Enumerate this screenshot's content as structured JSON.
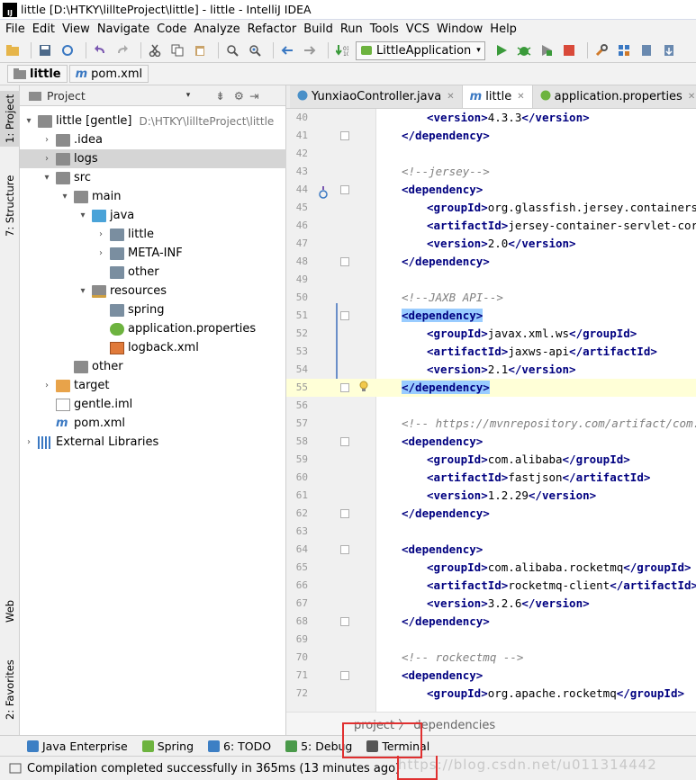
{
  "window": {
    "title": "little [D:\\HTKY\\lillteProject\\little] - little - IntelliJ IDEA",
    "app_icon_text": "IJ"
  },
  "menu": [
    "File",
    "Edit",
    "View",
    "Navigate",
    "Code",
    "Analyze",
    "Refactor",
    "Build",
    "Run",
    "Tools",
    "VCS",
    "Window",
    "Help"
  ],
  "toolbar": {
    "run_config": "LittleApplication"
  },
  "navbar": {
    "project": "little",
    "file": "pom.xml"
  },
  "left_tabs": {
    "project": "1: Project",
    "structure": "7: Structure",
    "web": "Web",
    "favorites": "2: Favorites"
  },
  "project_panel": {
    "title": "Project"
  },
  "tree": [
    {
      "label": "little [gentle]",
      "extra": "D:\\HTKY\\lillteProject\\little",
      "arrow": "▾",
      "icon": "folder",
      "depth": 0
    },
    {
      "label": ".idea",
      "arrow": "›",
      "icon": "folder",
      "depth": 1
    },
    {
      "label": "logs",
      "arrow": "›",
      "icon": "folder",
      "depth": 1
    },
    {
      "label": "src",
      "arrow": "▾",
      "icon": "folder",
      "depth": 1
    },
    {
      "label": "main",
      "arrow": "▾",
      "icon": "folder",
      "depth": 2
    },
    {
      "label": "java",
      "arrow": "▾",
      "icon": "folder-blue",
      "depth": 3
    },
    {
      "label": "little",
      "arrow": "›",
      "icon": "package",
      "depth": 4
    },
    {
      "label": "META-INF",
      "arrow": "›",
      "icon": "package",
      "depth": 4
    },
    {
      "label": "other",
      "arrow": "",
      "icon": "package",
      "depth": 4
    },
    {
      "label": "resources",
      "arrow": "▾",
      "icon": "folder-res",
      "depth": 3
    },
    {
      "label": "spring",
      "arrow": "",
      "icon": "package",
      "depth": 4
    },
    {
      "label": "application.properties",
      "arrow": "",
      "icon": "properties",
      "depth": 4
    },
    {
      "label": "logback.xml",
      "arrow": "",
      "icon": "xml",
      "depth": 4
    },
    {
      "label": "other",
      "arrow": "",
      "icon": "folder",
      "depth": 2
    },
    {
      "label": "target",
      "arrow": "›",
      "icon": "folder-orange",
      "depth": 1
    },
    {
      "label": "gentle.iml",
      "arrow": "",
      "icon": "iml",
      "depth": 1
    },
    {
      "label": "pom.xml",
      "arrow": "",
      "icon": "maven",
      "depth": 1
    },
    {
      "label": "External Libraries",
      "arrow": "›",
      "icon": "libraries",
      "depth": 0
    }
  ],
  "editor_tabs": [
    {
      "label": "YunxiaoController.java",
      "icon": "class",
      "active": false
    },
    {
      "label": "little",
      "icon": "maven",
      "active": true
    },
    {
      "label": "application.properties",
      "icon": "properties",
      "active": false
    }
  ],
  "code_lines": [
    {
      "n": "40",
      "indent": 2,
      "parts": [
        [
          "tag",
          "<version>"
        ],
        [
          "text",
          "4.3.3"
        ],
        [
          "tag",
          "</version>"
        ]
      ]
    },
    {
      "n": "41",
      "indent": 1,
      "parts": [
        [
          "tag",
          "</dependency>"
        ]
      ]
    },
    {
      "n": "42",
      "indent": 0,
      "parts": []
    },
    {
      "n": "43",
      "indent": 1,
      "parts": [
        [
          "comment",
          "<!--jersey-->"
        ]
      ]
    },
    {
      "n": "44",
      "indent": 1,
      "parts": [
        [
          "tag",
          "<dependency>"
        ]
      ]
    },
    {
      "n": "45",
      "indent": 2,
      "parts": [
        [
          "tag",
          "<groupId>"
        ],
        [
          "text",
          "org.glassfish.jersey.containers"
        ],
        [
          "tag",
          "</"
        ]
      ]
    },
    {
      "n": "46",
      "indent": 2,
      "parts": [
        [
          "tag",
          "<artifactId>"
        ],
        [
          "text",
          "jersey-container-servlet-core"
        ]
      ]
    },
    {
      "n": "47",
      "indent": 2,
      "parts": [
        [
          "tag",
          "<version>"
        ],
        [
          "text",
          "2.0"
        ],
        [
          "tag",
          "</version>"
        ]
      ]
    },
    {
      "n": "48",
      "indent": 1,
      "parts": [
        [
          "tag",
          "</dependency>"
        ]
      ]
    },
    {
      "n": "49",
      "indent": 0,
      "parts": []
    },
    {
      "n": "50",
      "indent": 1,
      "parts": [
        [
          "comment",
          "<!--JAXB API-->"
        ]
      ]
    },
    {
      "n": "51",
      "indent": 1,
      "parts": [
        [
          "taghl",
          "<dependency>"
        ]
      ]
    },
    {
      "n": "52",
      "indent": 2,
      "parts": [
        [
          "tag",
          "<groupId>"
        ],
        [
          "text",
          "javax.xml.ws"
        ],
        [
          "tag",
          "</groupId>"
        ]
      ]
    },
    {
      "n": "53",
      "indent": 2,
      "parts": [
        [
          "tag",
          "<artifactId>"
        ],
        [
          "text",
          "jaxws-api"
        ],
        [
          "tag",
          "</artifactId>"
        ]
      ]
    },
    {
      "n": "54",
      "indent": 2,
      "parts": [
        [
          "tag",
          "<version>"
        ],
        [
          "text",
          "2.1"
        ],
        [
          "tag",
          "</version>"
        ]
      ]
    },
    {
      "n": "55",
      "indent": 1,
      "parts": [
        [
          "taghl",
          "</dependency>"
        ]
      ]
    },
    {
      "n": "56",
      "indent": 0,
      "parts": []
    },
    {
      "n": "57",
      "indent": 1,
      "parts": [
        [
          "comment",
          "<!-- https://mvnrepository.com/artifact/com.ali"
        ]
      ]
    },
    {
      "n": "58",
      "indent": 1,
      "parts": [
        [
          "tag",
          "<dependency>"
        ]
      ]
    },
    {
      "n": "59",
      "indent": 2,
      "parts": [
        [
          "tag",
          "<groupId>"
        ],
        [
          "text",
          "com.alibaba"
        ],
        [
          "tag",
          "</groupId>"
        ]
      ]
    },
    {
      "n": "60",
      "indent": 2,
      "parts": [
        [
          "tag",
          "<artifactId>"
        ],
        [
          "text",
          "fastjson"
        ],
        [
          "tag",
          "</artifactId>"
        ]
      ]
    },
    {
      "n": "61",
      "indent": 2,
      "parts": [
        [
          "tag",
          "<version>"
        ],
        [
          "text",
          "1.2.29"
        ],
        [
          "tag",
          "</version>"
        ]
      ]
    },
    {
      "n": "62",
      "indent": 1,
      "parts": [
        [
          "tag",
          "</dependency>"
        ]
      ]
    },
    {
      "n": "63",
      "indent": 0,
      "parts": []
    },
    {
      "n": "64",
      "indent": 1,
      "parts": [
        [
          "tag",
          "<dependency>"
        ]
      ]
    },
    {
      "n": "65",
      "indent": 2,
      "parts": [
        [
          "tag",
          "<groupId>"
        ],
        [
          "text",
          "com.alibaba.rocketmq"
        ],
        [
          "tag",
          "</groupId>"
        ]
      ]
    },
    {
      "n": "66",
      "indent": 2,
      "parts": [
        [
          "tag",
          "<artifactId>"
        ],
        [
          "text",
          "rocketmq-client"
        ],
        [
          "tag",
          "</artifactId>"
        ]
      ]
    },
    {
      "n": "67",
      "indent": 2,
      "parts": [
        [
          "tag",
          "<version>"
        ],
        [
          "text",
          "3.2.6"
        ],
        [
          "tag",
          "</version>"
        ]
      ]
    },
    {
      "n": "68",
      "indent": 1,
      "parts": [
        [
          "tag",
          "</dependency>"
        ]
      ]
    },
    {
      "n": "69",
      "indent": 0,
      "parts": []
    },
    {
      "n": "70",
      "indent": 1,
      "parts": [
        [
          "comment",
          "<!-- rockectmq -->"
        ]
      ]
    },
    {
      "n": "71",
      "indent": 1,
      "parts": [
        [
          "tag",
          "<dependency>"
        ]
      ]
    },
    {
      "n": "72",
      "indent": 2,
      "parts": [
        [
          "tag",
          "<groupId>"
        ],
        [
          "text",
          "org.apache.rocketmq"
        ],
        [
          "tag",
          "</groupId>"
        ]
      ]
    }
  ],
  "editor_breadcrumb": "project 〉 dependencies",
  "bottom_tools": [
    {
      "label": "Java Enterprise",
      "color": "#3d7fc4"
    },
    {
      "label": "Spring",
      "color": "#6db33f"
    },
    {
      "label": "6: TODO",
      "color": "#3d7fc4"
    },
    {
      "label": "5: Debug",
      "color": "#4a9a4a"
    },
    {
      "label": "Terminal",
      "color": "#555555"
    }
  ],
  "status": "Compilation completed successfully in 365ms (13 minutes ago)",
  "watermark": "https://blog.csdn.net/u011314442"
}
